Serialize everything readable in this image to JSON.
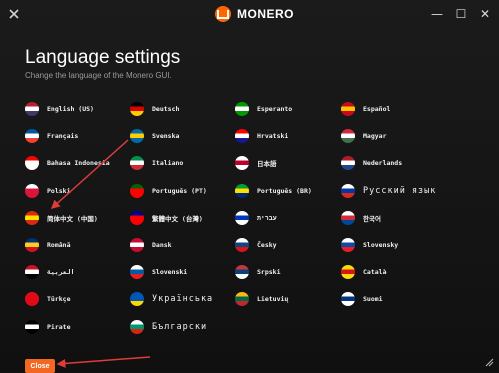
{
  "app": {
    "name": "MONERO"
  },
  "window_controls": {
    "minimize": "—",
    "maximize": "☐",
    "close": "✕"
  },
  "page": {
    "title": "Language settings",
    "subtitle": "Change the language of the Monero GUI."
  },
  "languages": [
    {
      "label": "English (US)",
      "flag": [
        "#b22234",
        "#ffffff",
        "#3c3b6e"
      ]
    },
    {
      "label": "Deutsch",
      "flag": [
        "#000000",
        "#dd0000",
        "#ffce00"
      ]
    },
    {
      "label": "Esperanto",
      "flag": [
        "#009900",
        "#ffffff",
        "#009900"
      ]
    },
    {
      "label": "Español",
      "flag": [
        "#c60b1e",
        "#ffc400",
        "#c60b1e"
      ]
    },
    {
      "label": "Français",
      "flag": [
        "#0055a4",
        "#ffffff",
        "#ef4135"
      ]
    },
    {
      "label": "Svenska",
      "flag": [
        "#006aa7",
        "#fecc00",
        "#006aa7"
      ]
    },
    {
      "label": "Hrvatski",
      "flag": [
        "#ff0000",
        "#ffffff",
        "#171796"
      ]
    },
    {
      "label": "Magyar",
      "flag": [
        "#cd2a3e",
        "#ffffff",
        "#436f4d"
      ]
    },
    {
      "label": "Bahasa Indonesia",
      "flag": [
        "#ff0000",
        "#ffffff",
        "#ffffff"
      ]
    },
    {
      "label": "Italiano",
      "flag": [
        "#009246",
        "#ffffff",
        "#ce2b37"
      ]
    },
    {
      "label": "日本語",
      "flag": [
        "#ffffff",
        "#bc002d",
        "#ffffff"
      ]
    },
    {
      "label": "Nederlands",
      "flag": [
        "#ae1c28",
        "#ffffff",
        "#21468b"
      ]
    },
    {
      "label": "Polski",
      "flag": [
        "#ffffff",
        "#dc143c",
        "#dc143c"
      ]
    },
    {
      "label": "Português (PT)",
      "flag": [
        "#006600",
        "#ff0000",
        "#ff0000"
      ]
    },
    {
      "label": "Português (BR)",
      "flag": [
        "#009c3b",
        "#ffdf00",
        "#002776"
      ]
    },
    {
      "label": "Русский язык",
      "flag": [
        "#ffffff",
        "#0039a6",
        "#d52b1e"
      ]
    },
    {
      "label": "简体中文 (中国)",
      "flag": [
        "#de2910",
        "#ffde00",
        "#de2910"
      ]
    },
    {
      "label": "繁體中文 (台灣)",
      "flag": [
        "#000095",
        "#fe0000",
        "#fe0000"
      ]
    },
    {
      "label": "עברית",
      "flag": [
        "#ffffff",
        "#0038b8",
        "#ffffff"
      ]
    },
    {
      "label": "한국어",
      "flag": [
        "#ffffff",
        "#cd2e3a",
        "#0047a0"
      ]
    },
    {
      "label": "Română",
      "flag": [
        "#002b7f",
        "#fcd116",
        "#ce1126"
      ]
    },
    {
      "label": "Dansk",
      "flag": [
        "#c60c30",
        "#ffffff",
        "#c60c30"
      ]
    },
    {
      "label": "Česky",
      "flag": [
        "#ffffff",
        "#11457e",
        "#d7141a"
      ]
    },
    {
      "label": "Slovensky",
      "flag": [
        "#ffffff",
        "#0b4ea2",
        "#ee1c25"
      ]
    },
    {
      "label": "العربية",
      "flag": [
        "#ce1126",
        "#ffffff",
        "#000000"
      ]
    },
    {
      "label": "Slovenski",
      "flag": [
        "#ffffff",
        "#005da4",
        "#ed1c24"
      ]
    },
    {
      "label": "Srpski",
      "flag": [
        "#c6363c",
        "#0c4076",
        "#ffffff"
      ]
    },
    {
      "label": "Català",
      "flag": [
        "#fcdd09",
        "#da121a",
        "#fcdd09"
      ]
    },
    {
      "label": "Türkçe",
      "flag": [
        "#e30a17",
        "#e30a17",
        "#e30a17"
      ]
    },
    {
      "label": "Українська",
      "flag": [
        "#0057b7",
        "#0057b7",
        "#ffd700"
      ]
    },
    {
      "label": "Lietuvių",
      "flag": [
        "#fdb913",
        "#006a44",
        "#c1272d"
      ]
    },
    {
      "label": "Suomi",
      "flag": [
        "#ffffff",
        "#003580",
        "#ffffff"
      ]
    },
    {
      "label": "Pirate",
      "flag": [
        "#000000",
        "#ffffff",
        "#000000"
      ]
    },
    {
      "label": "Български",
      "flag": [
        "#ffffff",
        "#00966e",
        "#d62612"
      ]
    }
  ],
  "footer": {
    "close_label": "Close"
  },
  "colors": {
    "accent": "#f26722",
    "background": "#131313",
    "arrow": "#e03b3b"
  }
}
